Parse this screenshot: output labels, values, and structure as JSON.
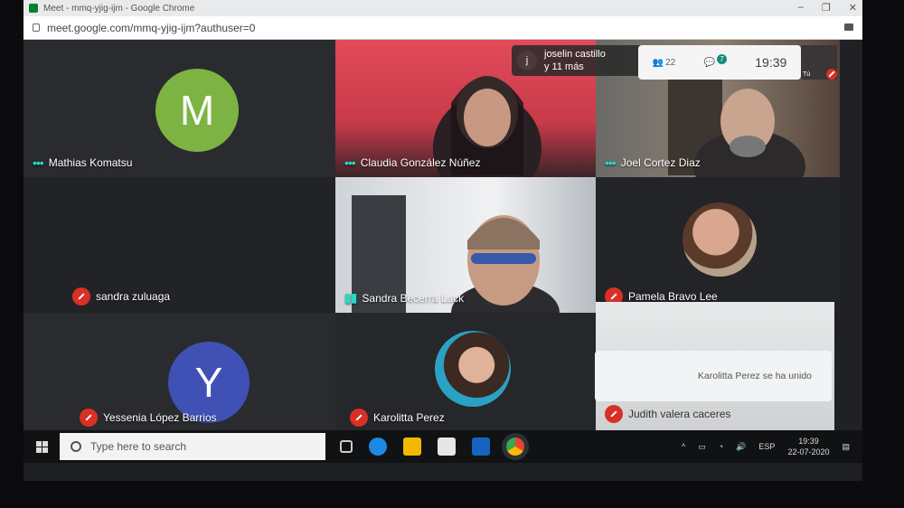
{
  "browser": {
    "tab_title": "Meet - mmq-yjig-ijm - Google Chrome",
    "url": "meet.google.com/mmq-yjig-ijm?authuser=0",
    "window_controls": [
      "–",
      "❐",
      "✕"
    ]
  },
  "meet_header": {
    "top_participant_initial": "j",
    "top_participant_text_1": "joselin castillo",
    "top_participant_text_2": "y 11 más",
    "people_count": "22",
    "chat_count": "7",
    "time": "19:39",
    "self_label": "Tú"
  },
  "participants": [
    {
      "name": "Mathias Komatsu",
      "initial": "M",
      "avatar_color": "#7cb342"
    },
    {
      "name": "Claudia González Núñez"
    },
    {
      "name": "Joel Cortez Diaz"
    },
    {
      "name": "sandra zuluaga"
    },
    {
      "name": "Sandra Becerra Luck"
    },
    {
      "name": "Pamela Bravo Lee"
    },
    {
      "name": "Yessenia López Barrios",
      "initial": "Y",
      "avatar_color": "#3f51b5"
    },
    {
      "name": "Karolitta Perez"
    },
    {
      "name": "Judith valera caceres"
    }
  ],
  "toast": {
    "message": "Karolitta Perez se ha unido"
  },
  "taskbar": {
    "search_placeholder": "Type here to search",
    "language": "ESP",
    "clock_time": "19:39",
    "clock_date": "22-07-2020"
  }
}
